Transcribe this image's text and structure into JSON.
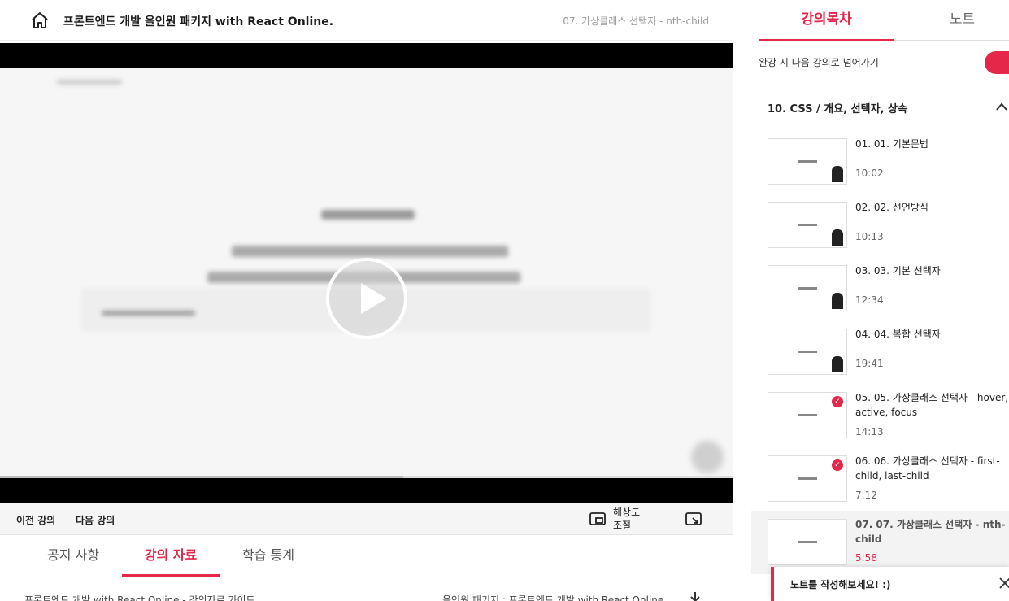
{
  "header": {
    "course_title": "프론트엔드 개발 올인원 패키지 with React Online.",
    "current_lesson": "07. 가상클래스 선택자 - nth-child"
  },
  "controls": {
    "prev": "이전 강의",
    "next": "다음 강의",
    "resolution": "해상도 조절"
  },
  "tabs": [
    {
      "label": "공지 사항"
    },
    {
      "label": "강의 자료"
    },
    {
      "label": "학습 통계"
    }
  ],
  "resources": {
    "title": "프론트엔드 개발 with React Online - 강의자료 가이드",
    "package": "올인원 패키지 : 프론트엔드 개발 with React Online"
  },
  "sidebar": {
    "tab_curriculum": "강의목차",
    "tab_note": "노트",
    "autoplay_label": "완강 시 다음 강의로 넘어가기",
    "section_title": "10. CSS / 개요, 선택자, 상속",
    "lessons": [
      {
        "title": "01. 01. 기본문법",
        "time": "10:02",
        "done": false
      },
      {
        "title": "02. 02. 선언방식",
        "time": "10:13",
        "done": false
      },
      {
        "title": "03. 03. 기본 선택자",
        "time": "12:34",
        "done": false
      },
      {
        "title": "04. 04. 복합 선택자",
        "time": "19:41",
        "done": false
      },
      {
        "title": "05. 05. 가상클래스 선택자 - hover, active, focus",
        "time": "14:13",
        "done": true
      },
      {
        "title": "06. 06. 가상클래스 선택자 - first-child, last-child",
        "time": "7:12",
        "done": true
      },
      {
        "title": "07. 07. 가상클래스 선택자 - nth-child",
        "time": "5:58",
        "done": false
      }
    ]
  },
  "note_popup": {
    "text": "노트를 작성해보세요! :)"
  },
  "colors": {
    "accent": "#e5274a"
  }
}
